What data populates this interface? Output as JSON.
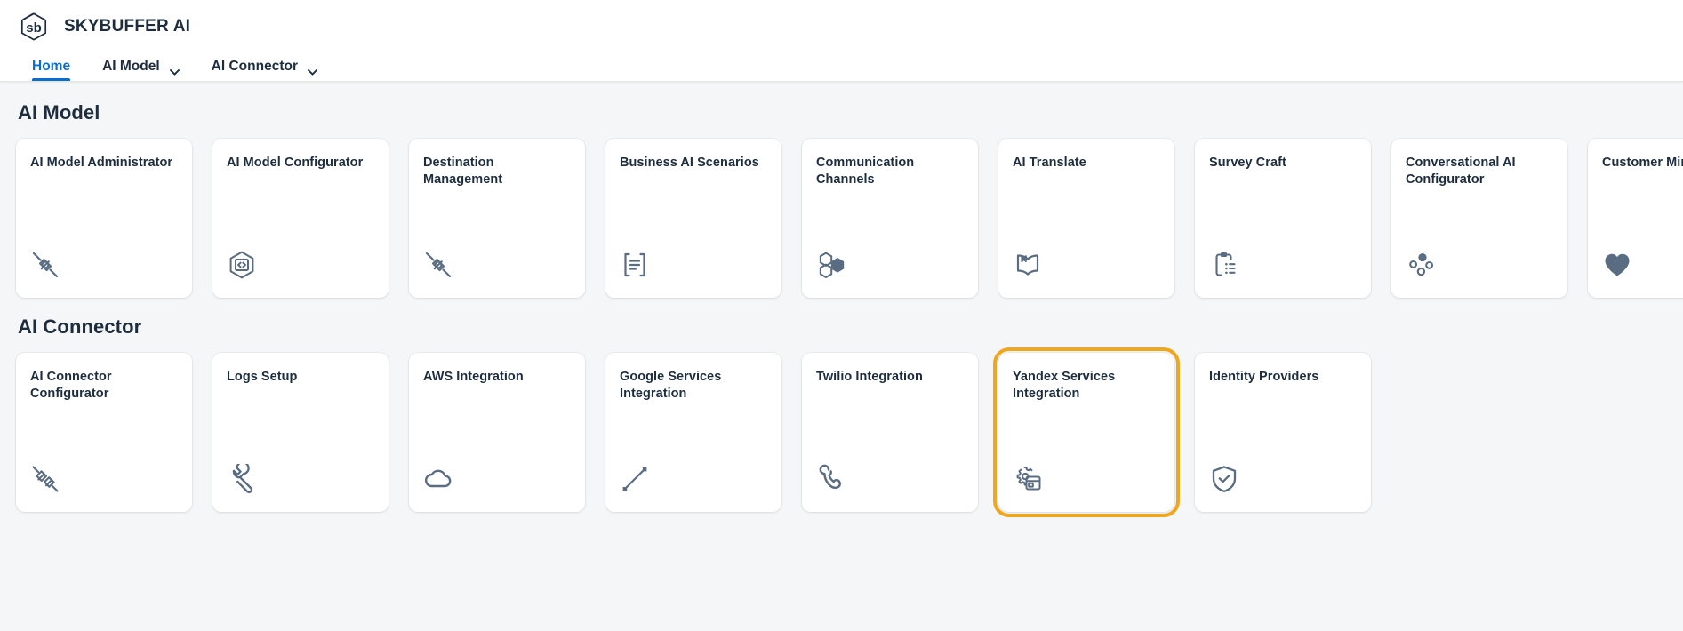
{
  "app": {
    "brand_title": "SKYBUFFER AI",
    "logo_icon": "skybuffer-hexagon-sb-logo",
    "accent_color": "#0a6ed1",
    "selection_color": "#efa81d",
    "icon_color": "#5a6c82",
    "text_color": "#1d2d3e",
    "background_color": "#f5f6f7"
  },
  "nav": {
    "items": [
      {
        "label": "Home",
        "active": true,
        "has_chevron": false,
        "chevron_icon": ""
      },
      {
        "label": "AI Model",
        "active": false,
        "has_chevron": true,
        "chevron_icon": "chevron-down-icon"
      },
      {
        "label": "AI Connector",
        "active": false,
        "has_chevron": true,
        "chevron_icon": "chevron-down-icon"
      }
    ]
  },
  "sections": [
    {
      "title": "AI Model",
      "cards": [
        {
          "title": "AI Model Administrator",
          "icon": "connector-plug-icon",
          "selected": false
        },
        {
          "title": "AI Model Configurator",
          "icon": "hexagon-code-icon",
          "selected": false
        },
        {
          "title": "Destination Management",
          "icon": "connector-plug-icon",
          "selected": false
        },
        {
          "title": "Business AI Scenarios",
          "icon": "document-text-icon",
          "selected": false
        },
        {
          "title": "Communication Channels",
          "icon": "hexagon-cluster-icon",
          "selected": false
        },
        {
          "title": "AI Translate",
          "icon": "open-book-icon",
          "selected": false
        },
        {
          "title": "Survey Craft",
          "icon": "clipboard-checklist-icon",
          "selected": false
        },
        {
          "title": "Conversational AI Configurator",
          "icon": "dot-cluster-icon",
          "selected": false
        },
        {
          "title": "Customer Mindset",
          "icon": "heart-icon",
          "selected": false
        }
      ]
    },
    {
      "title": "AI Connector",
      "cards": [
        {
          "title": "AI Connector Configurator",
          "icon": "disconnected-plug-icon",
          "selected": false
        },
        {
          "title": "Logs Setup",
          "icon": "wrench-icon",
          "selected": false
        },
        {
          "title": "AWS Integration",
          "icon": "cloud-icon",
          "selected": false
        },
        {
          "title": "Google Services Integration",
          "icon": "diagonal-line-icon",
          "selected": false
        },
        {
          "title": "Twilio Integration",
          "icon": "phone-handset-icon",
          "selected": false
        },
        {
          "title": "Yandex Services Integration",
          "icon": "gear-window-icon",
          "selected": true
        },
        {
          "title": "Identity Providers",
          "icon": "shield-check-icon",
          "selected": false
        }
      ]
    }
  ]
}
